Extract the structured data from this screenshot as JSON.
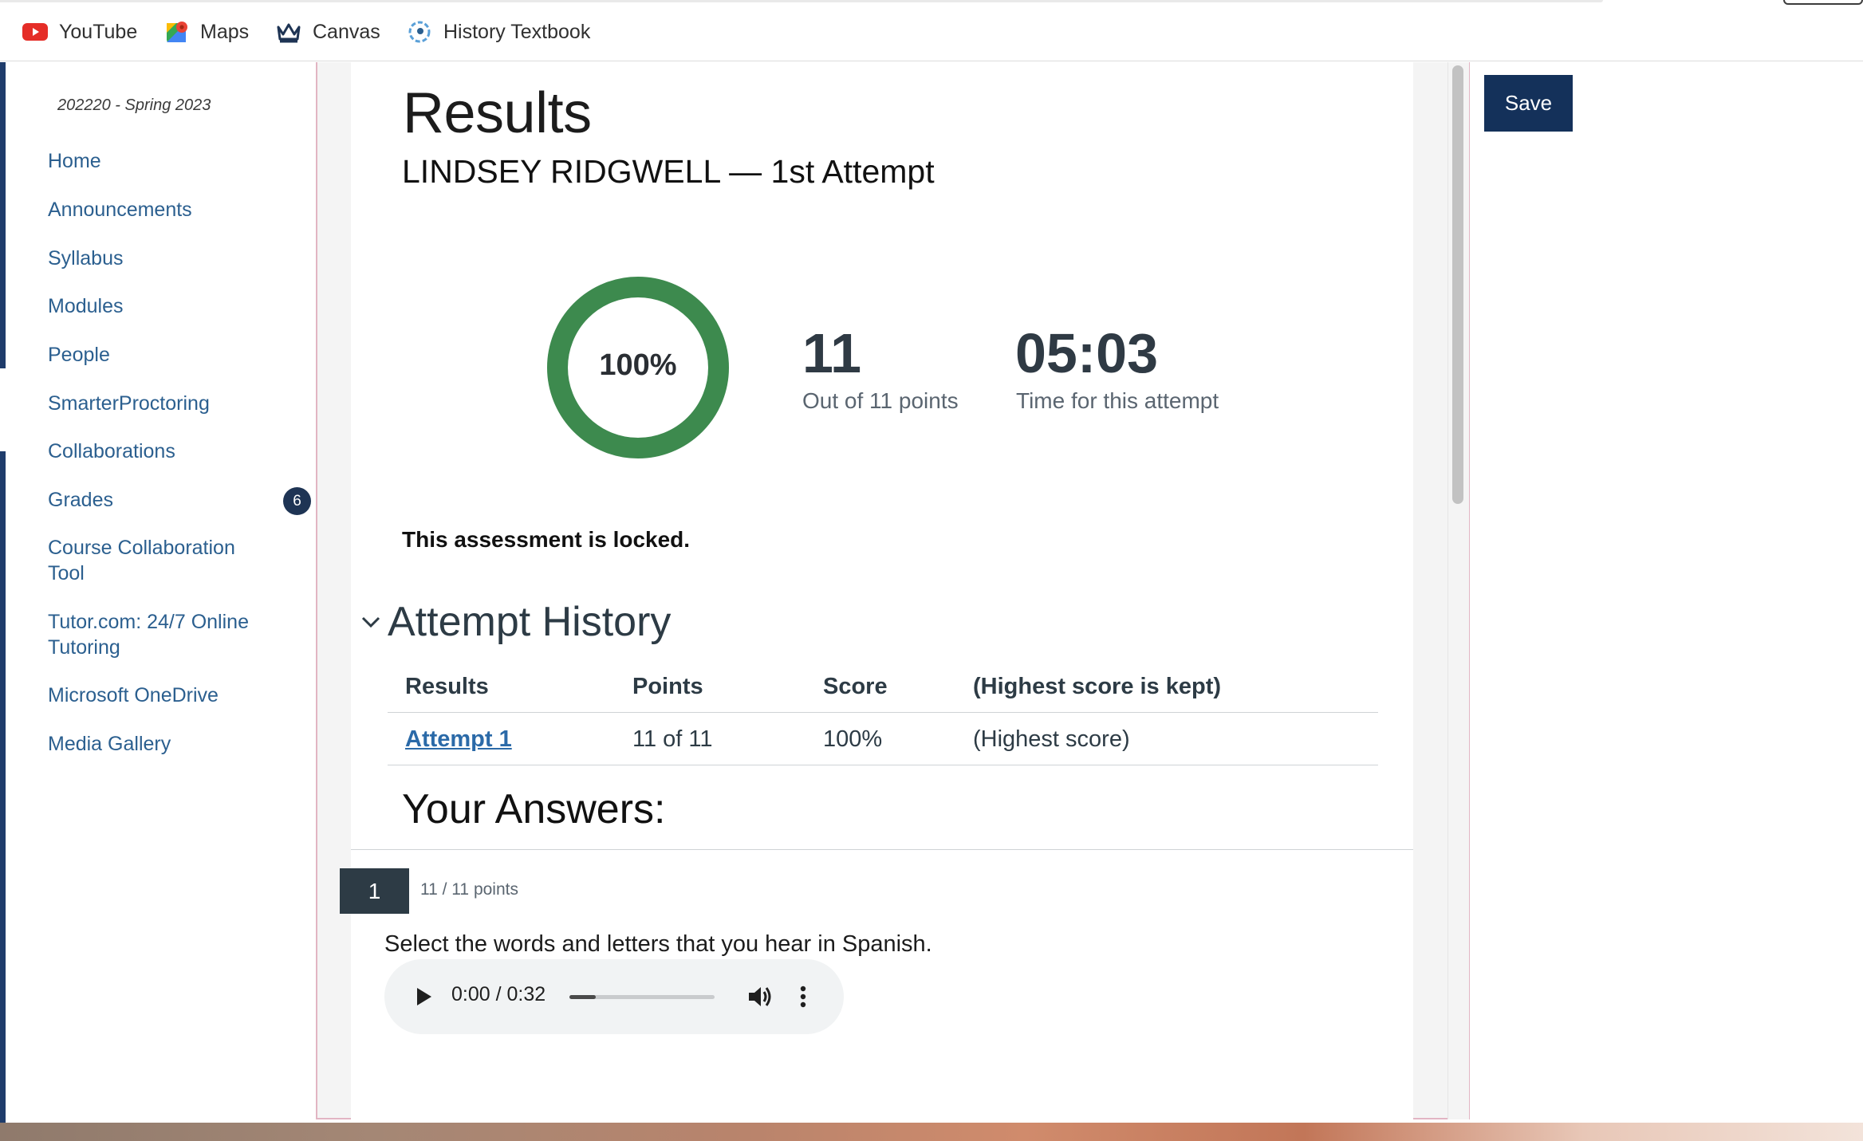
{
  "bookmarks": [
    {
      "label": "YouTube",
      "icon": "youtube-icon"
    },
    {
      "label": "Maps",
      "icon": "maps-icon"
    },
    {
      "label": "Canvas",
      "icon": "canvas-icon"
    },
    {
      "label": "History Textbook",
      "icon": "history-textbook-icon"
    }
  ],
  "course_nav": {
    "term": "202220 - Spring 2023",
    "items": [
      {
        "label": "Home"
      },
      {
        "label": "Announcements"
      },
      {
        "label": "Syllabus"
      },
      {
        "label": "Modules"
      },
      {
        "label": "People"
      },
      {
        "label": "SmarterProctoring"
      },
      {
        "label": "Collaborations"
      },
      {
        "label": "Grades",
        "badge": "6"
      },
      {
        "label": "Course Collaboration Tool"
      },
      {
        "label": "Tutor.com: 24/7 Online Tutoring"
      },
      {
        "label": "Microsoft OneDrive"
      },
      {
        "label": "Media Gallery"
      }
    ]
  },
  "save_label": "Save",
  "results": {
    "title": "Results",
    "student_attempt": "LINDSEY RIDGWELL — 1st Attempt",
    "score_percent": "100%",
    "score_fraction": 1.0,
    "points": "11",
    "points_caption": "Out of 11 points",
    "time": "05:03",
    "time_caption": "Time for this attempt",
    "locked_message": "This assessment is locked."
  },
  "attempt_history": {
    "title": "Attempt History",
    "columns": [
      "Results",
      "Points",
      "Score",
      "(Highest score is kept)"
    ],
    "rows": [
      {
        "results": "Attempt 1",
        "points": "11 of 11",
        "score": "100%",
        "note": "(Highest score)"
      }
    ]
  },
  "answers": {
    "title": "Your Answers:",
    "question": {
      "number": "1",
      "points": "11 / 11 points",
      "text": "Select the words and letters that you hear in Spanish."
    },
    "audio": {
      "time": "0:00 / 0:32",
      "progress": 0.18
    }
  },
  "colors": {
    "ring": "#3d8a4e",
    "save_button": "#14315a",
    "nav_link": "#2b5f8f",
    "badge": "#1e3454"
  }
}
